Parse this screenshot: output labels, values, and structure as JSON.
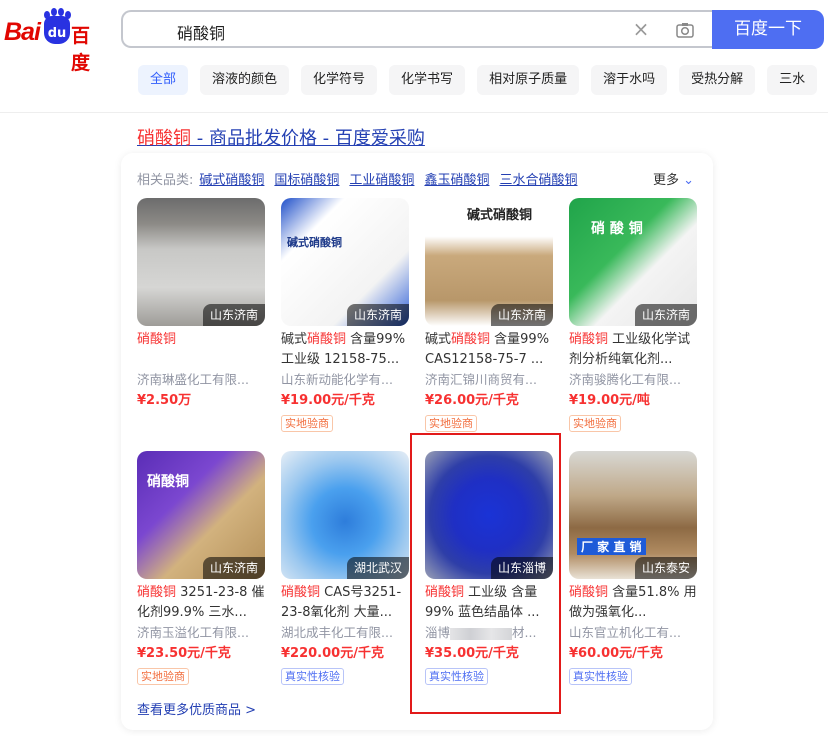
{
  "header": {
    "logo_bai": "Bai",
    "logo_du": "du",
    "logo_cn": "百度",
    "search_value": "硝酸铜",
    "search_button": "百度一下"
  },
  "tabs": [
    "全部",
    "溶液的颜色",
    "化学符号",
    "化学书写",
    "相对原子质量",
    "溶于水吗",
    "受热分解",
    "三水"
  ],
  "result": {
    "title_hl": "硝酸铜",
    "title_rest": " - 商品批发价格 - 百度爱采购"
  },
  "related": {
    "label": "相关品类:",
    "links": [
      "碱式硝酸铜",
      "国标硝酸铜",
      "工业硝酸铜",
      "鑫玉硝酸铜",
      "三水合硝酸铜"
    ],
    "more": "更多"
  },
  "products": [
    {
      "loc": "山东济南",
      "title_hl": "硝酸铜",
      "title_rest": "",
      "company": "济南琳盛化工有限...",
      "price": "¥2.50万",
      "badge": "",
      "img_text": ""
    },
    {
      "loc": "山东济南",
      "title_pre": "碱式",
      "title_hl": "硝酸铜",
      "title_rest": " 含量99% 工业级 12158-75...",
      "company": "山东新动能化学有...",
      "price": "¥19.00元/千克",
      "badge": "实地验商",
      "img_text": "碱式硝酸铜"
    },
    {
      "loc": "山东济南",
      "title_pre": "碱式",
      "title_hl": "硝酸铜",
      "title_rest": " 含量99% CAS12158-75-7 ...",
      "company": "济南汇锦川商贸有...",
      "price": "¥26.00元/千克",
      "badge": "实地验商",
      "img_text": "碱式硝酸铜"
    },
    {
      "loc": "山东济南",
      "title_pre": "",
      "title_hl": "硝酸铜",
      "title_rest": " 工业级化学试剂分析纯氧化剂...",
      "company": "济南骏腾化工有限...",
      "price": "¥19.00元/吨",
      "badge": "实地验商",
      "img_text": "硝 酸 铜"
    },
    {
      "loc": "山东济南",
      "title_pre": "",
      "title_hl": "硝酸铜",
      "title_rest": " 3251-23-8 催化剂99.9% 三水...",
      "company": "济南玉溢化工有限...",
      "price": "¥23.50元/千克",
      "badge": "实地验商",
      "img_text": "硝酸铜"
    },
    {
      "loc": "湖北武汉",
      "title_pre": "",
      "title_hl": "硝酸铜",
      "title_rest": " CAS号3251-23-8氧化剂 大量...",
      "company": "湖北成丰化工有限...",
      "price": "¥220.00元/千克",
      "badge": "真实性核验",
      "img_text": ""
    },
    {
      "loc": "山东淄博",
      "title_pre": "",
      "title_hl": "硝酸铜",
      "title_rest": " 工业级 含量99% 蓝色结晶体 ...",
      "company_pre": "淄博",
      "company_post": "材...",
      "price": "¥35.00元/千克",
      "badge": "真实性核验",
      "img_text": ""
    },
    {
      "loc": "山东泰安",
      "title_pre": "",
      "title_hl": "硝酸铜",
      "title_rest": " 含量51.8% 用做为强氧化...",
      "company": "山东官立机化工有...",
      "price": "¥60.00元/千克",
      "badge": "真实性核验",
      "img_text": "厂 家 直 销"
    }
  ],
  "view_more": "查看更多优质商品 >",
  "colors": {
    "accent": "#4e6ef2",
    "highlight": "#f73131",
    "link": "#2440b3",
    "box": "#e21a1a"
  }
}
